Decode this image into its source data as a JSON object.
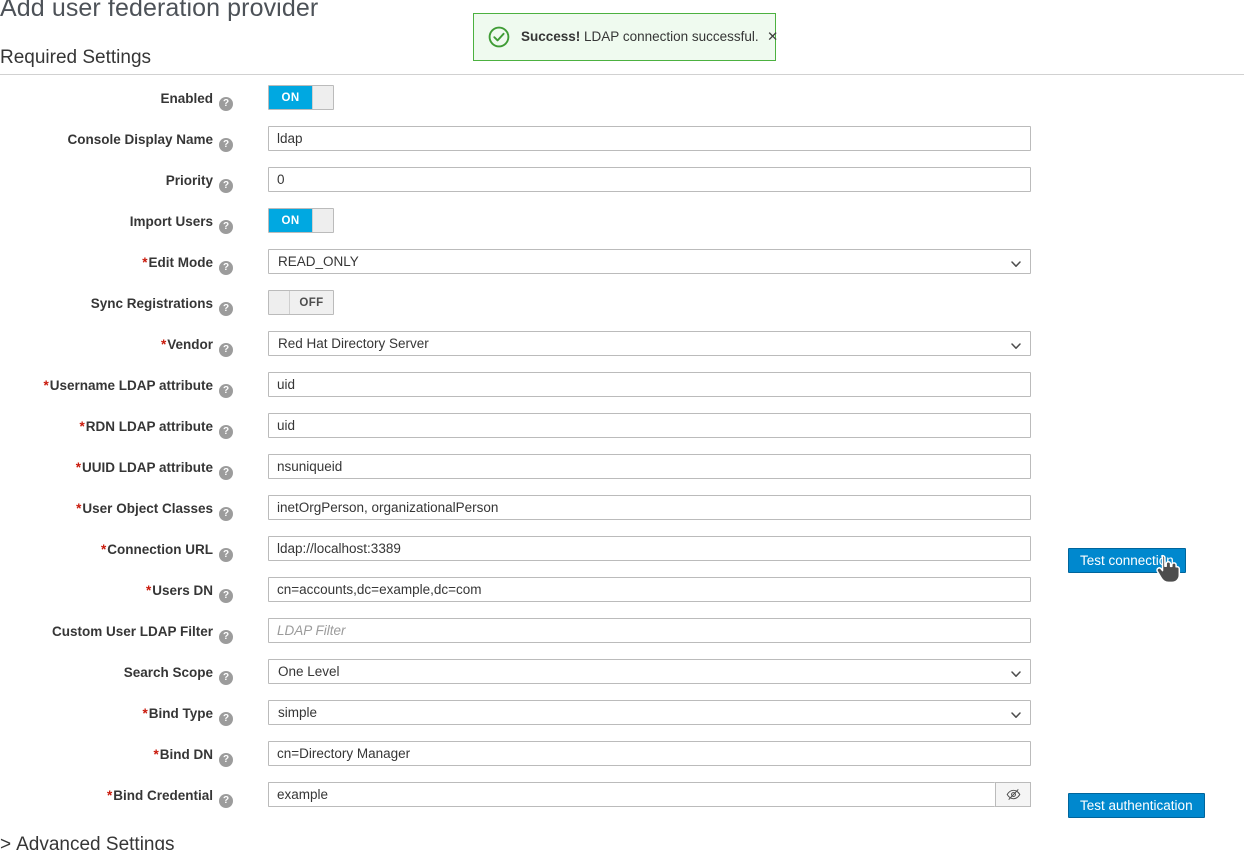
{
  "page": {
    "title": "Add user federation provider",
    "section_title": "Required Settings",
    "advanced_section": "Advanced Settings",
    "advanced_caret": ">"
  },
  "alert": {
    "icon": "circle-check-icon",
    "strong": "Success!",
    "message": " LDAP connection successful.",
    "close_glyph": "✕",
    "border_color": "#4cb140",
    "background_color": "#effaef"
  },
  "theme": {
    "accent": "#0088ce",
    "toggle_on": "#00a8e1",
    "required_marker": "#c9190b",
    "help_icon_bg": "#9c9c9c"
  },
  "help_glyph": "?",
  "required_marker": "*",
  "fields": [
    {
      "label": "Enabled",
      "required": false,
      "type": "toggle",
      "value": "ON"
    },
    {
      "label": "Console Display Name",
      "required": false,
      "type": "text",
      "value": "ldap",
      "placeholder": ""
    },
    {
      "label": "Priority",
      "required": false,
      "type": "text",
      "value": "0",
      "placeholder": ""
    },
    {
      "label": "Import Users",
      "required": false,
      "type": "toggle",
      "value": "ON"
    },
    {
      "label": "Edit Mode",
      "required": true,
      "type": "select",
      "value": "READ_ONLY"
    },
    {
      "label": "Sync Registrations",
      "required": false,
      "type": "toggle",
      "value": "OFF"
    },
    {
      "label": "Vendor",
      "required": true,
      "type": "select",
      "value": "Red Hat Directory Server"
    },
    {
      "label": "Username LDAP attribute",
      "required": true,
      "type": "text",
      "value": "uid",
      "placeholder": ""
    },
    {
      "label": "RDN LDAP attribute",
      "required": true,
      "type": "text",
      "value": "uid",
      "placeholder": ""
    },
    {
      "label": "UUID LDAP attribute",
      "required": true,
      "type": "text",
      "value": "nsuniqueid",
      "placeholder": ""
    },
    {
      "label": "User Object Classes",
      "required": true,
      "type": "text",
      "value": "inetOrgPerson, organizationalPerson",
      "placeholder": ""
    },
    {
      "label": "Connection URL",
      "required": true,
      "type": "text",
      "value": "ldap://localhost:3389",
      "placeholder": ""
    },
    {
      "label": "Users DN",
      "required": true,
      "type": "text",
      "value": "cn=accounts,dc=example,dc=com",
      "placeholder": ""
    },
    {
      "label": "Custom User LDAP Filter",
      "required": false,
      "type": "text",
      "value": "",
      "placeholder": "LDAP Filter"
    },
    {
      "label": "Search Scope",
      "required": false,
      "type": "select",
      "value": "One Level"
    },
    {
      "label": "Bind Type",
      "required": true,
      "type": "select",
      "value": "simple"
    },
    {
      "label": "Bind DN",
      "required": true,
      "type": "text",
      "value": "cn=Directory Manager",
      "placeholder": ""
    },
    {
      "label": "Bind Credential",
      "required": true,
      "type": "password",
      "value": "example",
      "placeholder": "",
      "reveal_icon": "eye-slash-icon"
    }
  ],
  "buttons": {
    "test_connection": "Test connection",
    "test_authentication": "Test authentication"
  },
  "cursor": {
    "icon": "pointing-hand-cursor"
  }
}
